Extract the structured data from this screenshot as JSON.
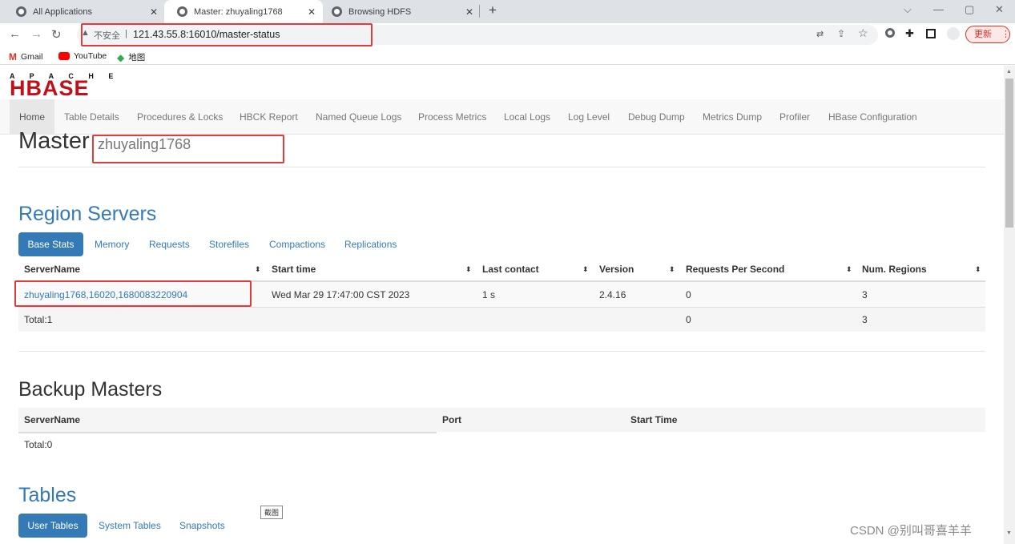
{
  "browser": {
    "tabs": [
      {
        "label": "All Applications"
      },
      {
        "label": "Master: zhuyaling1768"
      },
      {
        "label": "Browsing HDFS"
      }
    ],
    "new_tab": "+",
    "url_insecure": "不安全",
    "url": "121.43.55.8:16010/master-status",
    "update_label": "更新",
    "bookmarks": [
      {
        "label": "Gmail"
      },
      {
        "label": "YouTube"
      },
      {
        "label": "地图"
      }
    ]
  },
  "logo": {
    "top": "A P A C H E",
    "main": "HBASE"
  },
  "navbar": {
    "items": [
      {
        "label": "Home"
      },
      {
        "label": "Table Details"
      },
      {
        "label": "Procedures & Locks"
      },
      {
        "label": "HBCK Report"
      },
      {
        "label": "Named Queue Logs"
      },
      {
        "label": "Process Metrics"
      },
      {
        "label": "Local Logs"
      },
      {
        "label": "Log Level"
      },
      {
        "label": "Debug Dump"
      },
      {
        "label": "Metrics Dump"
      },
      {
        "label": "Profiler"
      },
      {
        "label": "HBase Configuration"
      }
    ]
  },
  "master": {
    "title": "Master",
    "host": "zhuyaling1768"
  },
  "region_servers": {
    "title": "Region Servers",
    "tabs": [
      "Base Stats",
      "Memory",
      "Requests",
      "Storefiles",
      "Compactions",
      "Replications"
    ],
    "columns": [
      "ServerName",
      "Start time",
      "Last contact",
      "Version",
      "Requests Per Second",
      "Num. Regions"
    ],
    "rows": [
      {
        "server": "zhuyaling1768,16020,1680083220904",
        "start": "Wed Mar 29 17:47:00 CST 2023",
        "contact": "1 s",
        "version": "2.4.16",
        "rps": "0",
        "regions": "3"
      }
    ],
    "total": {
      "label": "Total:1",
      "rps": "0",
      "regions": "3"
    }
  },
  "backup_masters": {
    "title": "Backup Masters",
    "columns": [
      "ServerName",
      "Port",
      "Start Time"
    ],
    "total": "Total:0"
  },
  "tables": {
    "title": "Tables",
    "tabs": [
      "User Tables",
      "System Tables",
      "Snapshots"
    ]
  },
  "tooltip": "截图",
  "watermark": "CSDN @别叫哥喜羊羊"
}
